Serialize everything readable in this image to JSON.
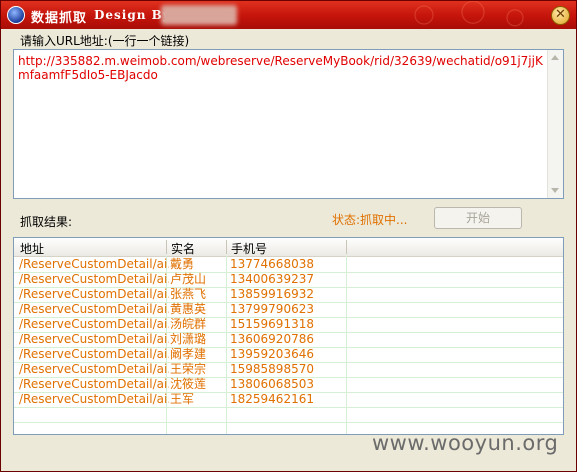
{
  "window": {
    "title": "数据抓取",
    "design_by": "Design By",
    "close_glyph": "✕"
  },
  "url_section": {
    "label": "请输入URL地址:(一行一个链接)",
    "value": "http://335882.m.weimob.com/webreserve/ReserveMyBook/rid/32639/wechatid/o91j7jjKmfaamfF5dIo5-EBJacdo"
  },
  "results": {
    "label": "抓取结果:",
    "status": "状态:抓取中...",
    "start_button": "开始"
  },
  "table": {
    "headers": [
      "地址",
      "实名",
      "手机号"
    ],
    "rows": [
      {
        "addr": "/ReserveCustomDetail/ai...",
        "name": "戴勇",
        "phone": "13774668038"
      },
      {
        "addr": "/ReserveCustomDetail/ai...",
        "name": "卢茂山",
        "phone": "13400639237"
      },
      {
        "addr": "/ReserveCustomDetail/ai...",
        "name": "张燕飞",
        "phone": "13859916932"
      },
      {
        "addr": "/ReserveCustomDetail/ai...",
        "name": "黄惠英",
        "phone": "13799790623"
      },
      {
        "addr": "/ReserveCustomDetail/ai...",
        "name": "汤皖群",
        "phone": "15159691318"
      },
      {
        "addr": "/ReserveCustomDetail/ai...",
        "name": "刘潇璐",
        "phone": "13606920786"
      },
      {
        "addr": "/ReserveCustomDetail/ai...",
        "name": "阚孝建",
        "phone": "13959203646"
      },
      {
        "addr": "/ReserveCustomDetail/ai...",
        "name": "王荣宗",
        "phone": "15985898570"
      },
      {
        "addr": "/ReserveCustomDetail/ai...",
        "name": "沈筱莲",
        "phone": "13806068503"
      },
      {
        "addr": "/ReserveCustomDetail/ai...",
        "name": "王军",
        "phone": "18259462161"
      }
    ]
  },
  "watermark": "www.wooyun.org",
  "colors": {
    "title_bar": "#c4140b",
    "url_text": "#e00000",
    "data_text": "#e07000",
    "status_text": "#e07000"
  }
}
